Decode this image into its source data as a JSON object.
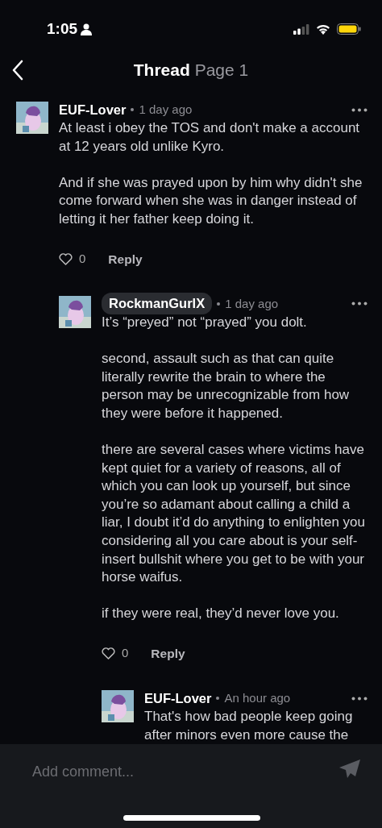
{
  "status_bar": {
    "time": "1:05"
  },
  "header": {
    "title": "Thread",
    "subtitle": "Page 1"
  },
  "comments": [
    {
      "author": "EUF-Lover",
      "highlighted": false,
      "time": "1 day ago",
      "paragraphs": [
        "At least i obey the TOS and don't make a account at 12 years old unlike Kyro.",
        "And if she was prayed upon by him why didn't she come forward when she was in danger instead of letting it her father keep doing it."
      ],
      "likes": "0",
      "liked": false,
      "reply": "Reply",
      "children": [
        {
          "author": "RockmanGurlX",
          "highlighted": true,
          "time": "1 day ago",
          "paragraphs": [
            "It’s “preyed” not “prayed” you dolt.",
            "second, assault such as that can quite literally rewrite the brain to where the person may be unrecognizable from how they were before it happened.",
            "there are several cases where victims have kept quiet for a variety of reasons, all of which you can look up yourself, but since you’re so adamant about calling a child a liar, I doubt it’d do anything to enlighten you considering all you care about is your self-insert bullshit where you get to be with your horse waifus.",
            "if they were real, they’d never love you."
          ],
          "likes": "0",
          "liked": false,
          "reply": "Reply",
          "children": [
            {
              "author": "EUF-Lover",
              "highlighted": false,
              "time": "An hour ago",
              "paragraphs": [
                "That's how bad people keep going after minors even more cause the"
              ]
            }
          ]
        }
      ]
    }
  ],
  "composer": {
    "placeholder": "Add comment..."
  }
}
